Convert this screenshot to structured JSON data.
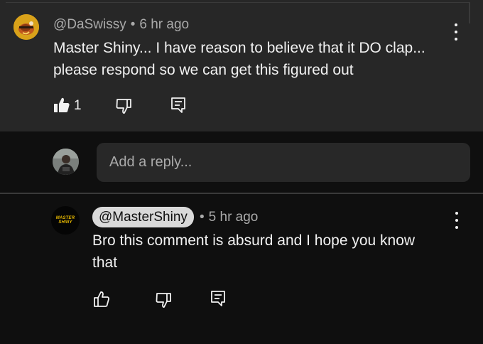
{
  "top_comment": {
    "author": "@DaSwissy",
    "separator": "•",
    "time": "6 hr ago",
    "text_line1": "Master Shiny... I have reason to believe that it DO clap...",
    "text_line2": "please respond so we can get this figured out",
    "like_count": "1",
    "icons": [
      "thumbs-up-filled-icon",
      "thumbs-down-outline-icon",
      "reply-comment-icon",
      "more-vert-icon"
    ]
  },
  "reply_input": {
    "placeholder": "Add a reply..."
  },
  "reply_comment": {
    "author": "@MasterShiny",
    "separator": "•",
    "time": "5 hr ago",
    "text_line1": "Bro this comment is absurd and I hope you know",
    "text_line2": "that",
    "avatar_text_line1": "MASTER",
    "avatar_text_line2": "SHINY",
    "icons": [
      "thumbs-up-outline-icon",
      "thumbs-down-outline-icon",
      "reply-comment-icon",
      "more-vert-icon"
    ]
  },
  "colors": {
    "background": "#0f0f0f",
    "highlight": "#272727",
    "text_primary": "#f1f1f1",
    "text_secondary": "#aaaaaa",
    "author_chip": "#d9d9d9",
    "avatar_yellow": "#d9a21a",
    "logo_gold": "#e6b800"
  }
}
